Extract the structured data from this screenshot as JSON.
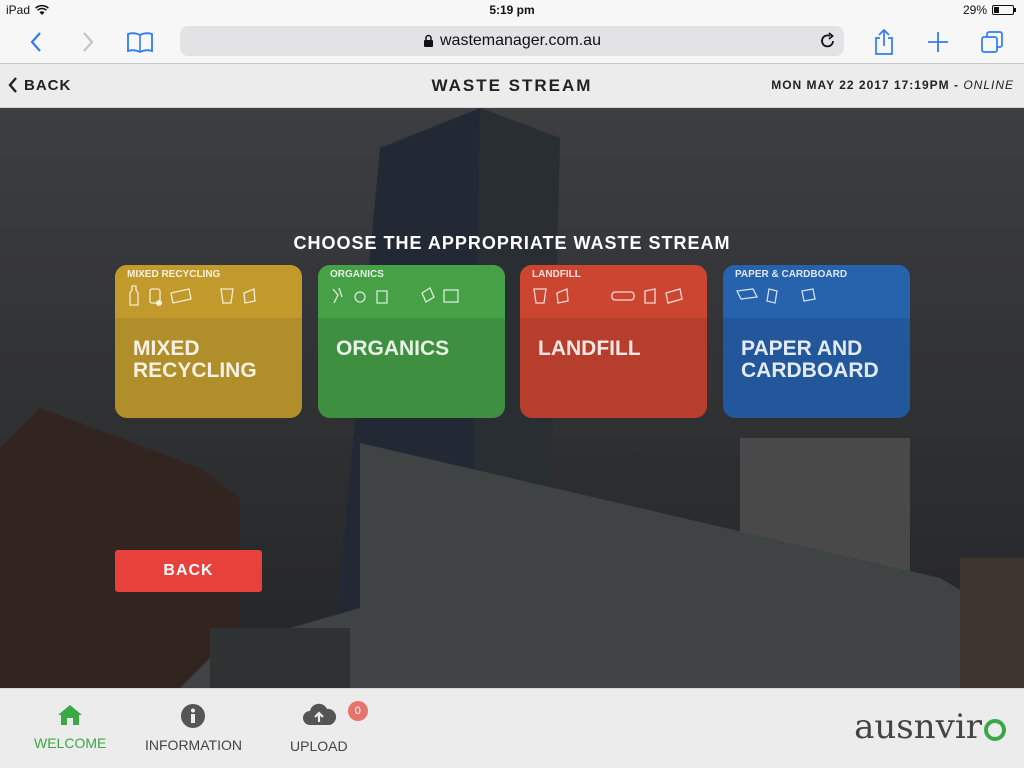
{
  "statusbar": {
    "device": "iPad",
    "time": "5:19 pm",
    "battery": "29%",
    "battery_level": 0.29
  },
  "browser": {
    "url": "wastemanager.com.au"
  },
  "header": {
    "back_label": "BACK",
    "title": "WASTE STREAM",
    "datetime": "MON MAY 22 2017 17:19PM",
    "separator": " - ",
    "status": "ONLINE"
  },
  "main": {
    "heading": "CHOOSE THE APPROPRIATE WASTE STREAM",
    "streams": [
      {
        "small_label": "MIXED RECYCLING",
        "line1": "MIXED",
        "line2": "RECYCLING",
        "color": "#c29a2c"
      },
      {
        "small_label": "ORGANICS",
        "line1": "ORGANICS",
        "line2": "",
        "color": "#46a046"
      },
      {
        "small_label": "LANDFILL",
        "line1": "LANDFILL",
        "line2": "",
        "color": "#cc4530"
      },
      {
        "small_label": "PAPER & CARDBOARD",
        "line1": "PAPER AND",
        "line2": "CARDBOARD",
        "color": "#2762ac"
      }
    ],
    "back_button": "BACK"
  },
  "tabbar": {
    "tabs": [
      {
        "label": "WELCOME",
        "icon": "home-icon",
        "active": true
      },
      {
        "label": "INFORMATION",
        "icon": "info-icon",
        "active": false
      },
      {
        "label": "UPLOAD",
        "icon": "cloud-upload-icon",
        "active": false
      }
    ],
    "upload_count": "0",
    "brand_text": "ausnvir",
    "accent_color": "#3aa845"
  }
}
